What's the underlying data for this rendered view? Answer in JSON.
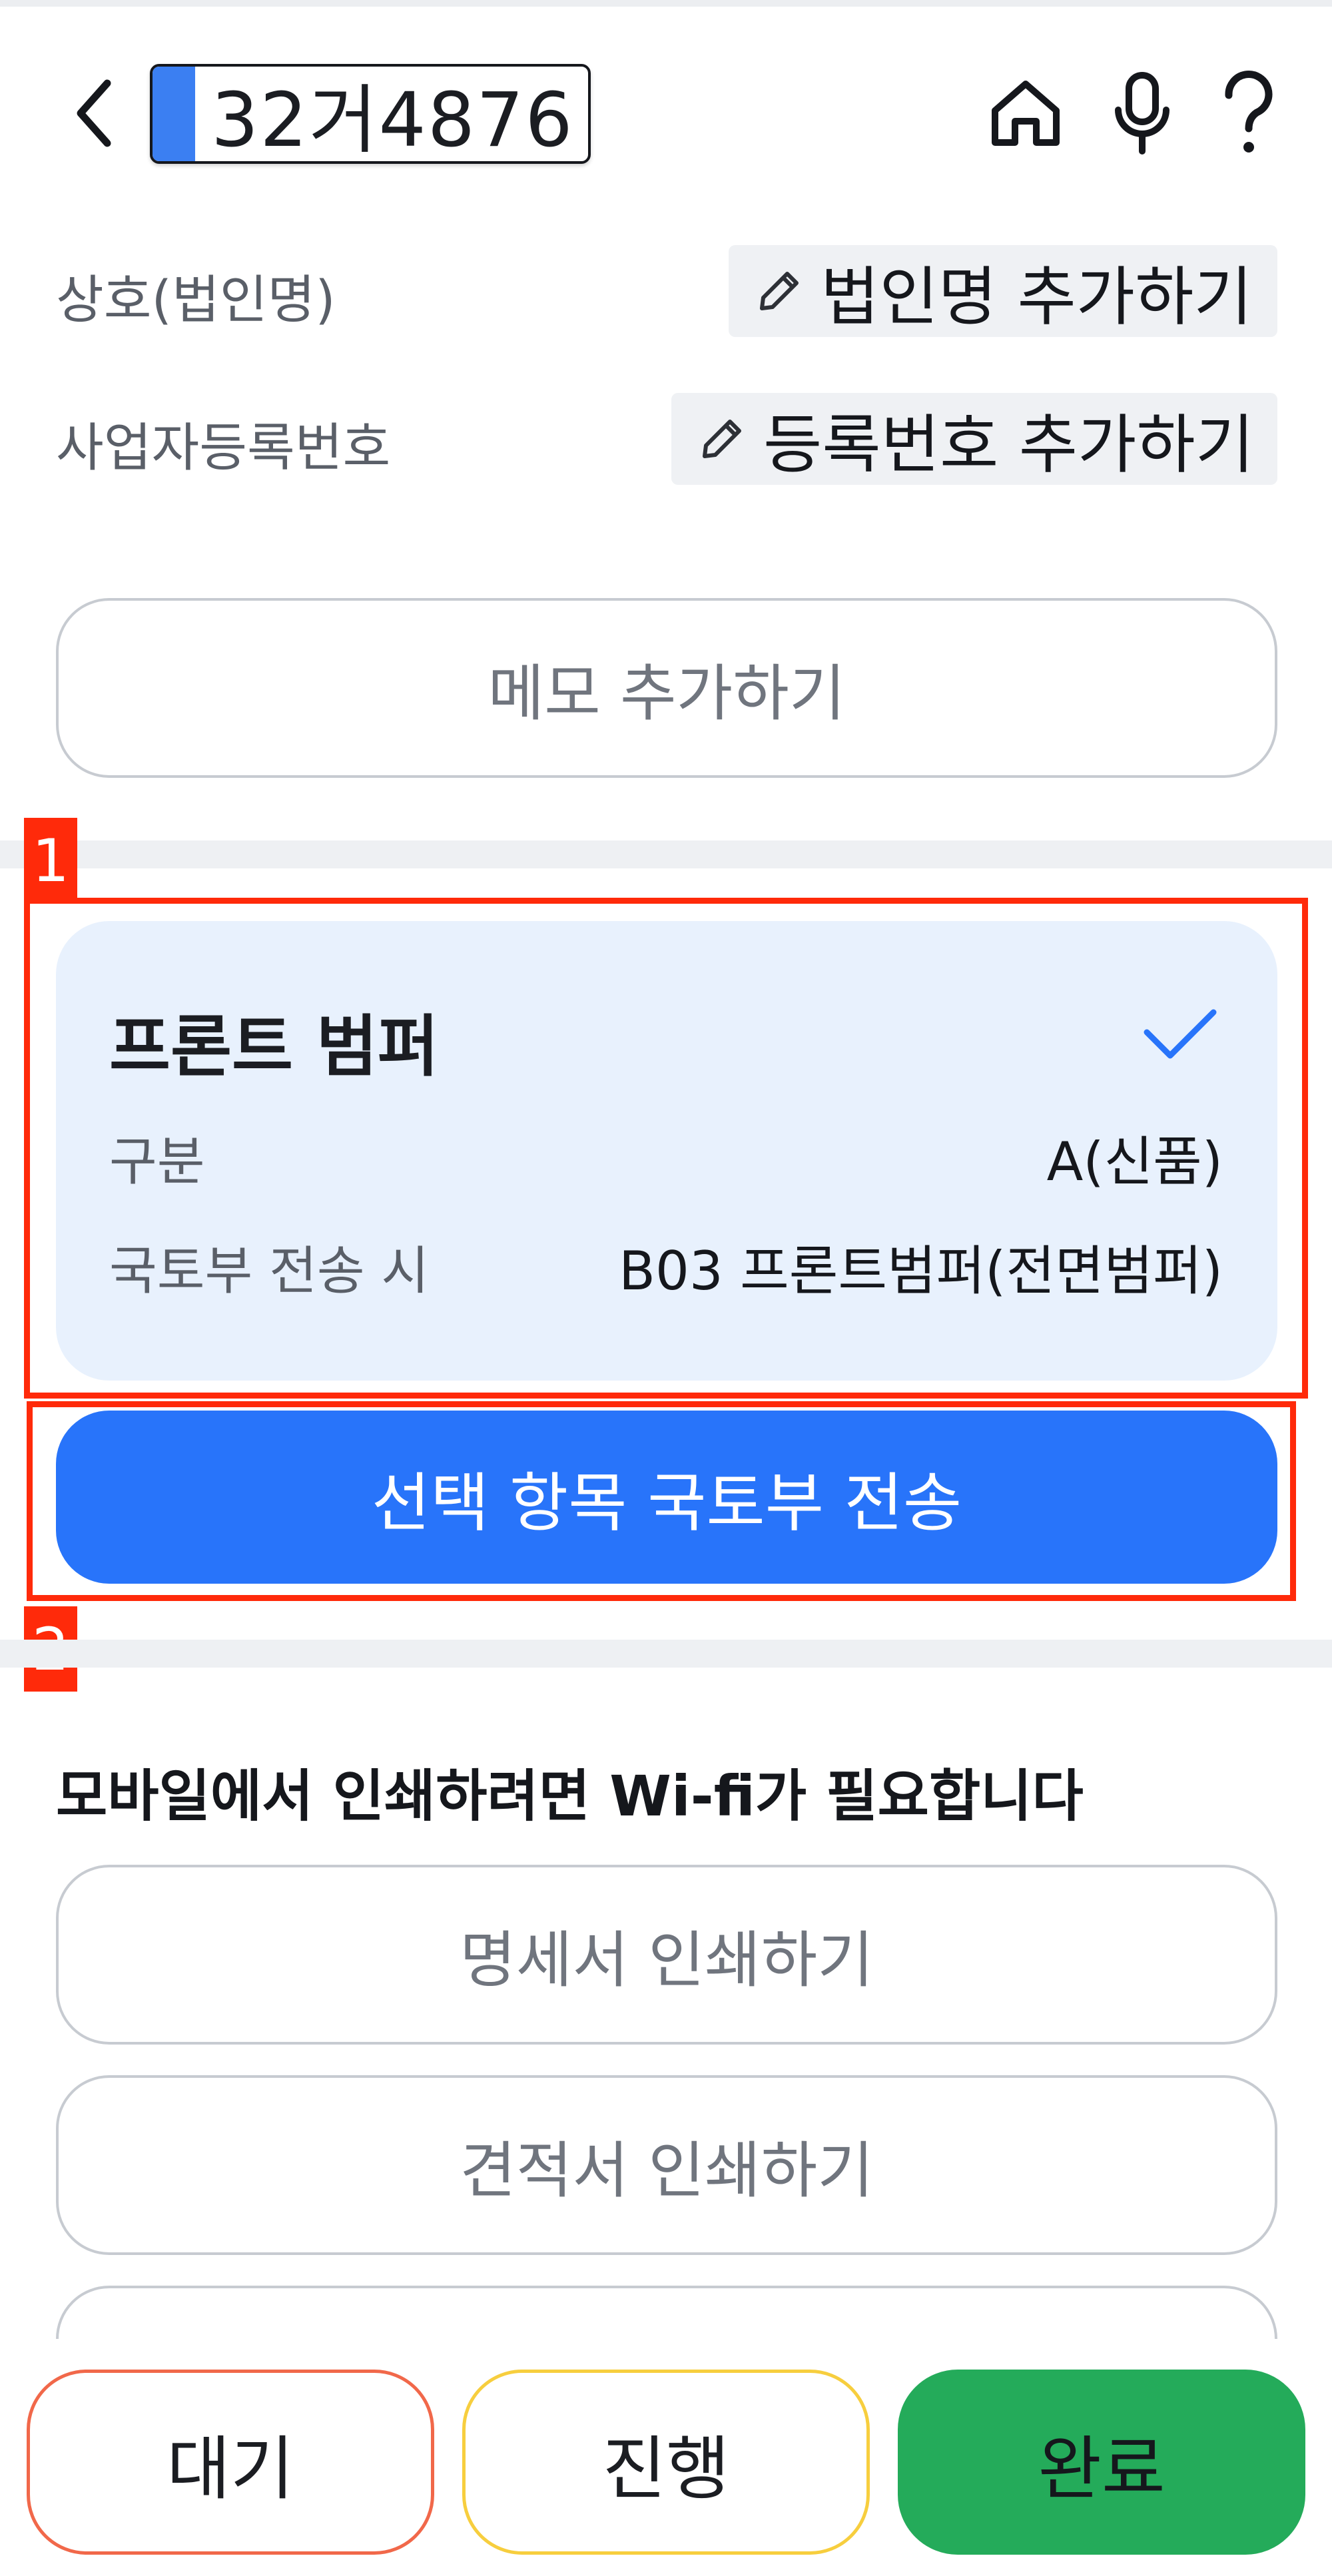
{
  "header": {
    "plate_number": "32거4876",
    "back_icon": "chevron-left-icon",
    "home_icon": "home-icon",
    "mic_icon": "microphone-icon",
    "help_icon": "question-icon"
  },
  "info": {
    "company_label": "상호(법인명)",
    "company_action": "법인명 추가하기",
    "biz_no_label": "사업자등록번호",
    "biz_no_action": "등록번호 추가하기",
    "memo_button": "메모 추가하기"
  },
  "annotations": {
    "tag1": "1",
    "tag2": "2",
    "color": "#ff2a0a"
  },
  "part": {
    "title": "프론트 범퍼",
    "rows": [
      {
        "label": "구분",
        "value": "A(신품)"
      },
      {
        "label": "국토부 전송 시",
        "value": "B03 프론트범퍼(전면범퍼)"
      }
    ]
  },
  "actions": {
    "send_selected": "선택 항목 국토부 전송",
    "print_note": "모바일에서 인쇄하려면 Wi-fi가 필요합니다",
    "print_statement": "명세서 인쇄하기",
    "print_estimate": "견적서 인쇄하기"
  },
  "status_bar": {
    "wait": "대기",
    "progress": "진행",
    "done": "완료"
  },
  "colors": {
    "primary": "#2874fa",
    "done": "#24ab5a",
    "wait_border": "#f1684a",
    "progress_border": "#f7ce3e",
    "card_bg": "#e8f1fd"
  }
}
